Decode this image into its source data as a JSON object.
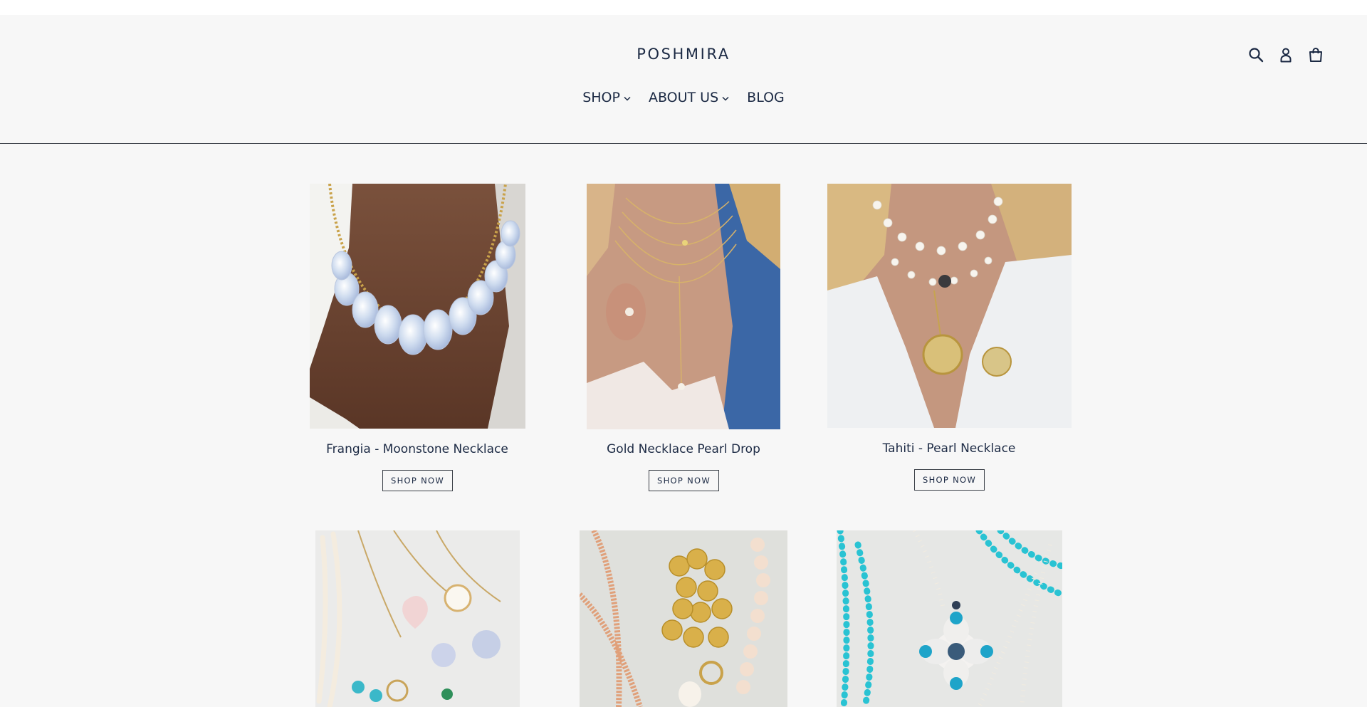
{
  "header": {
    "logo": "POSHMIRA",
    "nav": [
      {
        "label": "SHOP",
        "has_dropdown": true
      },
      {
        "label": "ABOUT US",
        "has_dropdown": true
      },
      {
        "label": "BLOG",
        "has_dropdown": false
      }
    ],
    "icons": [
      "search-icon",
      "account-icon",
      "cart-icon"
    ]
  },
  "products": [
    {
      "title": "Frangia - Moonstone Necklace",
      "button": "SHOP NOW"
    },
    {
      "title": "Gold Necklace Pearl Drop",
      "button": "SHOP NOW"
    },
    {
      "title": "Tahiti - Pearl Necklace",
      "button": "SHOP NOW"
    }
  ],
  "colors": {
    "text": "#1c2a44",
    "background": "#f7f7f7",
    "border": "#3a3f47"
  }
}
